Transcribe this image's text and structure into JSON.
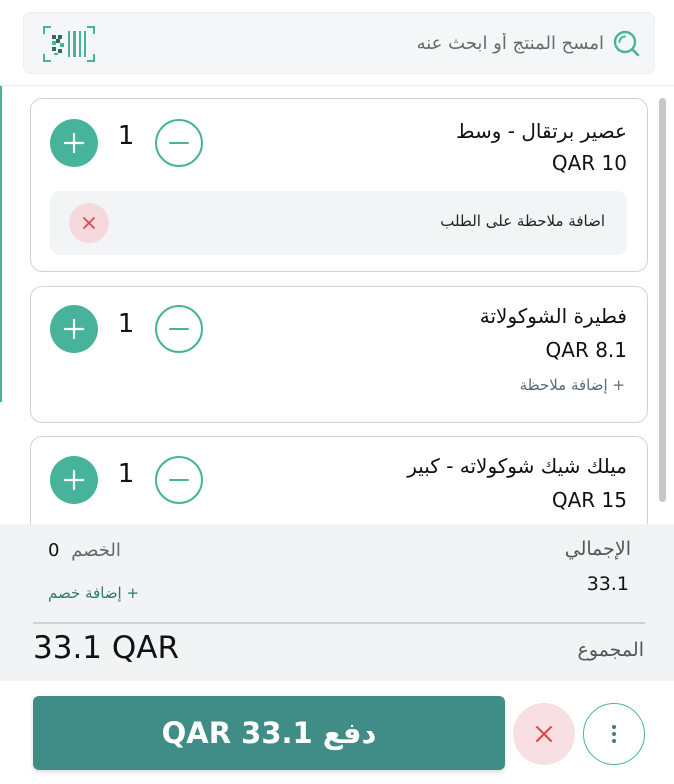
{
  "search": {
    "placeholder": "امسح المنتج أو ابحث عنه"
  },
  "cart": {
    "items": [
      {
        "name": "عصير برتقال - وسط",
        "price": "QAR 10",
        "quantity": "1",
        "note": "اضافة ملاحظة على الطلب"
      },
      {
        "name": "فطيرة الشوكولاتة",
        "price": "QAR 8.1",
        "quantity": "1",
        "add_note_label": "إضافة ملاحظة"
      },
      {
        "name": "ميلك شيك شوكولاته - كبير",
        "price": "QAR 15",
        "quantity": "1"
      }
    ]
  },
  "summary": {
    "total_label": "الإجمالي",
    "total_value": "33.1",
    "discount_label": "الخصم",
    "discount_value": "0",
    "add_discount_label": "إضافة خصم",
    "grand_total_label": "المجموع",
    "grand_total_value": "33.1 QAR"
  },
  "footer": {
    "pay_label": "دفع",
    "pay_amount": "QAR 33.1"
  },
  "colors": {
    "accent": "#48b39b",
    "pay_button": "#3f8d86",
    "danger": "#e0474c",
    "danger_bg": "#f8dfe1"
  },
  "icons": {
    "search": "search-icon",
    "barcode": "barcode-icon",
    "plus": "plus-icon",
    "minus": "minus-icon",
    "close": "close-icon",
    "more": "more-vertical-icon"
  }
}
